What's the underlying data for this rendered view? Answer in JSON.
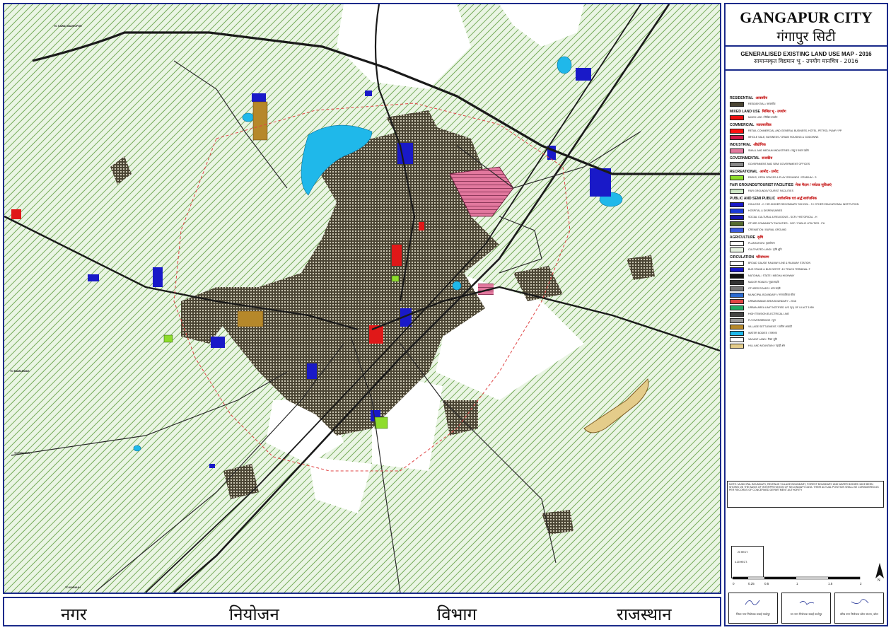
{
  "title": {
    "en": "GANGAPUR CITY",
    "hi": "गंगापुर सिटी"
  },
  "subtitle": {
    "en": "GENERALISED EXISTING LAND USE MAP - 2016",
    "hi": "सामान्यकृत विद्यमान भू - उपयोग मानचित्र - 2016"
  },
  "footer": {
    "words": [
      "नगर",
      "नियोजन",
      "विभाग",
      "राजस्थान"
    ]
  },
  "map": {
    "road_labels": [
      "TO SAWAI MADHOPUR",
      "TO HINDAUN",
      "TO BAMANWAS",
      "TO KARAULI"
    ],
    "colors": {
      "agricultural_bg": "#e8f3e2",
      "cultivated_hatch": "#5b9a3a",
      "residential": "#4b4534",
      "water": "#1fb8ea",
      "institutional": "#1919c8",
      "industrial": "#e2789e",
      "commercial": "#e01818",
      "recreational": "#8edc2c",
      "village": "#b6882a",
      "roads": "#1a1a1a",
      "hill": "#e4cc8a"
    }
  },
  "legend": {
    "categories": [
      {
        "en": "RESIDENTIAL",
        "hi": "आवासीय",
        "items": [
          {
            "label": "RESIDENTIAL / आवासीय",
            "color": "#4b4534"
          }
        ]
      },
      {
        "en": "MIXED LAND USE",
        "hi": "मिश्रित भू - उपयोग",
        "items": [
          {
            "label": "MIXED USE / मिश्रित उपयोग",
            "color": "#ee1111"
          }
        ]
      },
      {
        "en": "COMMERCIAL",
        "hi": "व्यावसायिक",
        "items": [
          {
            "label": "RETAIL COMMERCIAL AND GENERAL BUSINESS, HOTEL, PETROL PUMP / PP",
            "color": "#ff1010"
          },
          {
            "label": "WHOLE SALE, BUSINESS / GRAIN HOUSING & GODOWNS",
            "color": "#d01a4a"
          }
        ]
      },
      {
        "en": "INDUSTRIAL",
        "hi": "औद्योगिक",
        "items": [
          {
            "label": "SMALL AND MEDIUM INDUSTRIES / लघु व मध्यम उद्योग",
            "color": "#e2789e"
          }
        ]
      },
      {
        "en": "GOVERNMENTAL",
        "hi": "राजकीय",
        "items": [
          {
            "label": "GOVERNMENT AND SEMI GOVERNMENT OFFICES",
            "color": "#888888"
          }
        ]
      },
      {
        "en": "RECREATIONAL",
        "hi": "आमोद - प्रमोद",
        "items": [
          {
            "label": "PARKS, OPEN SPACES & PLAY GROUNDS / STADIUM - S",
            "color": "#8edc2c"
          }
        ]
      },
      {
        "en": "FAIR GROUNDS/TOURIST FACILITIES",
        "hi": "मेला मैदान / पर्यटक सुविधाएं",
        "items": [
          {
            "label": "FAIR GROUNDS/TOURIST FACILITIES",
            "color": "#cfe8c8"
          }
        ]
      },
      {
        "en": "PUBLIC AND SEMI PUBLIC",
        "hi": "सार्वजनिक एवं अर्द्ध सार्वजनिक",
        "items": [
          {
            "label": "COLLEGE - C / SR.HIGHER SECONDARY SCHOOL - S / OTHER EDUCATIONAL INSTITUTION",
            "color": "#1919c8"
          },
          {
            "label": "HOSPITAL & DISPENSARIES",
            "color": "#1a3ad8"
          },
          {
            "label": "SOCIAL CULTURAL & RELIGIOUS - SCR / HISTORICAL - H",
            "color": "#1616b0"
          },
          {
            "label": "OTHER COMMUNITY FACILITIES - OCF / PUBLIC UTILITIES - PU",
            "color": "#556b2f"
          },
          {
            "label": "CREMATION / BURIAL GROUND",
            "color": "#3a5ae0"
          }
        ]
      },
      {
        "en": "AGRICULTURE",
        "hi": "कृषि",
        "items": [
          {
            "label": "PLANTATION / वृक्षारोपण",
            "color": "#ffffff"
          },
          {
            "label": "CULTIVATED LAND / कृषि भूमि",
            "color": "#e8f3e2"
          }
        ]
      },
      {
        "en": "CIRCULATION",
        "hi": "परिसंचरण",
        "items": [
          {
            "label": "BROAD GAUGE RAILWAY LINE & RAILWAY STATION",
            "color": "#ffffff"
          },
          {
            "label": "BUS STAND & BUS DEPOT -B / TRUCK TERMINAL-T",
            "color": "#1919c8"
          },
          {
            "label": "NATIONAL / STATE / MEGHA HIGHWAY",
            "color": "#111111"
          },
          {
            "label": "MAJOR ROADS / मुख्य सड़कें",
            "color": "#333333"
          },
          {
            "label": "OTHERS ROADS / अन्य सड़कें",
            "color": "#777777"
          },
          {
            "label": "MUNICIPAL BOUNDARY / नगरपालिका सीमा",
            "color": "#2a6ad0"
          },
          {
            "label": "URBANISABLE AREA BOUNDARY - 2016",
            "color": "#e04444"
          },
          {
            "label": "URBAN AREA LIMIT NOTIFIED U/S 3(1) OF UI ACT 1959",
            "color": "#22aa66"
          },
          {
            "label": "HIGH TENSION ELECTRICAL LINE",
            "color": "#444444"
          },
          {
            "label": "FLYOVER/BRIDGE / पुल",
            "color": "#999999"
          },
          {
            "label": "VILLAGE SETTLEMENT / ग्रामीण आबादी",
            "color": "#b6882a"
          },
          {
            "label": "WATER BODIES / जलाशय",
            "color": "#1fb8ea"
          },
          {
            "label": "VACANT LAND / रिक्त भूमि",
            "color": "#ffffff"
          },
          {
            "label": "HILL AND MOUNTAIN / पहाड़ी क्षेत्र",
            "color": "#e4cc8a"
          }
        ]
      }
    ]
  },
  "note": "NOTE: MUNICIPAL BOUNDARY, REVENUE VILLAGE BOUNDARY, FOREST BOUNDARY AND WATER BODIES HAVE BEEN SHOWN ON THE BASIS OF INTERPRETATION OF SECONDARY DATA. THEIR ACTUAL POSITION SHALL BE CONSIDERED AS PER RECORDS OF CONCERNED DEPARTMENT AUTHORITY",
  "scale": {
    "box_label": "20 HECT.",
    "box_sublabel": "4.20 HECT.",
    "ticks": [
      "0",
      "0.25",
      "0.5",
      "1",
      "1.5",
      "2"
    ]
  },
  "signatures": [
    "जिला नगर नियोजक सवाई माधोपुर",
    "उप नगर नियोजक सवाई माधोपुर",
    "वरिष्ठ नगर नियोजक कोटा संभाग, कोटा"
  ]
}
